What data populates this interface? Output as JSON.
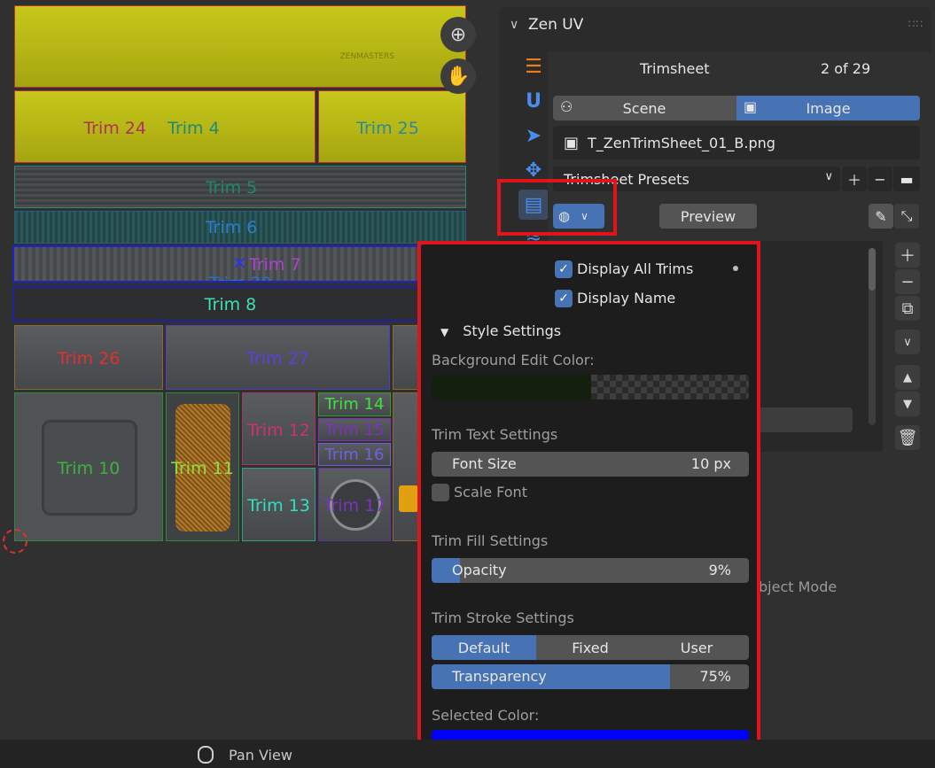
{
  "viewport": {
    "trims": [
      {
        "label": "Trim 24",
        "color": "#b0325a"
      },
      {
        "label": "Trim 4",
        "color": "#1e8a78"
      },
      {
        "label": "Trim 25",
        "color": "#2a8a9a"
      },
      {
        "label": "Trim 5",
        "color": "#1a8a6a"
      },
      {
        "label": "Trim 6",
        "color": "#2a7fd0"
      },
      {
        "label": "Trim 7",
        "color": "#b040d0"
      },
      {
        "label": "Trim 29",
        "color": "#2a70c0"
      },
      {
        "label": "Trim 8",
        "color": "#40e0b0"
      },
      {
        "label": "Trim 26",
        "color": "#e03030"
      },
      {
        "label": "Trim 27",
        "color": "#5a40e0"
      },
      {
        "label": "Trim 10",
        "color": "#40b040"
      },
      {
        "label": "Trim 11",
        "color": "#90e040"
      },
      {
        "label": "Trim 12",
        "color": "#d03070"
      },
      {
        "label": "Trim 14",
        "color": "#40e040"
      },
      {
        "label": "Trim 15",
        "color": "#8030c0"
      },
      {
        "label": "Trim 16",
        "color": "#7060e0"
      },
      {
        "label": "Trim 13",
        "color": "#30e0c0"
      },
      {
        "label": "Trim 17",
        "color": "#8030c0"
      }
    ],
    "stamp_text": "ZENMASTERS",
    "zoom_icon": "zoom-in-icon",
    "pan_icon": "hand-icon"
  },
  "panel": {
    "header_title": "Zen UV",
    "tabs": [
      "list-icon",
      "u-icon",
      "select-arrow-icon",
      "move-icon",
      "trimsheet-icon",
      "layers-icon"
    ],
    "section_title": "Trimsheet",
    "counter": "2 of 29",
    "mode_tabs": {
      "scene": "Scene",
      "image": "Image",
      "active": "Image"
    },
    "image_file": "T_ZenTrimSheet_01_B.png",
    "presets_label": "Trimsheet Presets",
    "preview_label": "Preview",
    "object_mode_text": "bject Mode"
  },
  "popup": {
    "display_all_trims": {
      "label": "Display All Trims",
      "checked": true
    },
    "display_name": {
      "label": "Display Name",
      "checked": true
    },
    "style_settings_label": "Style Settings",
    "bg_edit_color_label": "Background Edit Color:",
    "bg_edit_color": "#13200f",
    "trim_text_label": "Trim Text Settings",
    "font_size": {
      "label": "Font Size",
      "value": "10 px"
    },
    "scale_font": {
      "label": "Scale Font",
      "checked": false
    },
    "trim_fill_label": "Trim Fill Settings",
    "opacity": {
      "label": "Opacity",
      "value": "9%",
      "fraction": 0.09
    },
    "trim_stroke_label": "Trim Stroke Settings",
    "stroke_modes": [
      "Default",
      "Fixed",
      "User"
    ],
    "stroke_active": "Default",
    "transparency": {
      "label": "Transparency",
      "value": "75%",
      "fraction": 0.75
    },
    "selected_color_label": "Selected Color:",
    "selected_color": "#0000ff"
  },
  "status": {
    "pan_label": "Pan View"
  },
  "colors": {
    "accent": "#4772b3",
    "highlight": "#e0141a"
  }
}
